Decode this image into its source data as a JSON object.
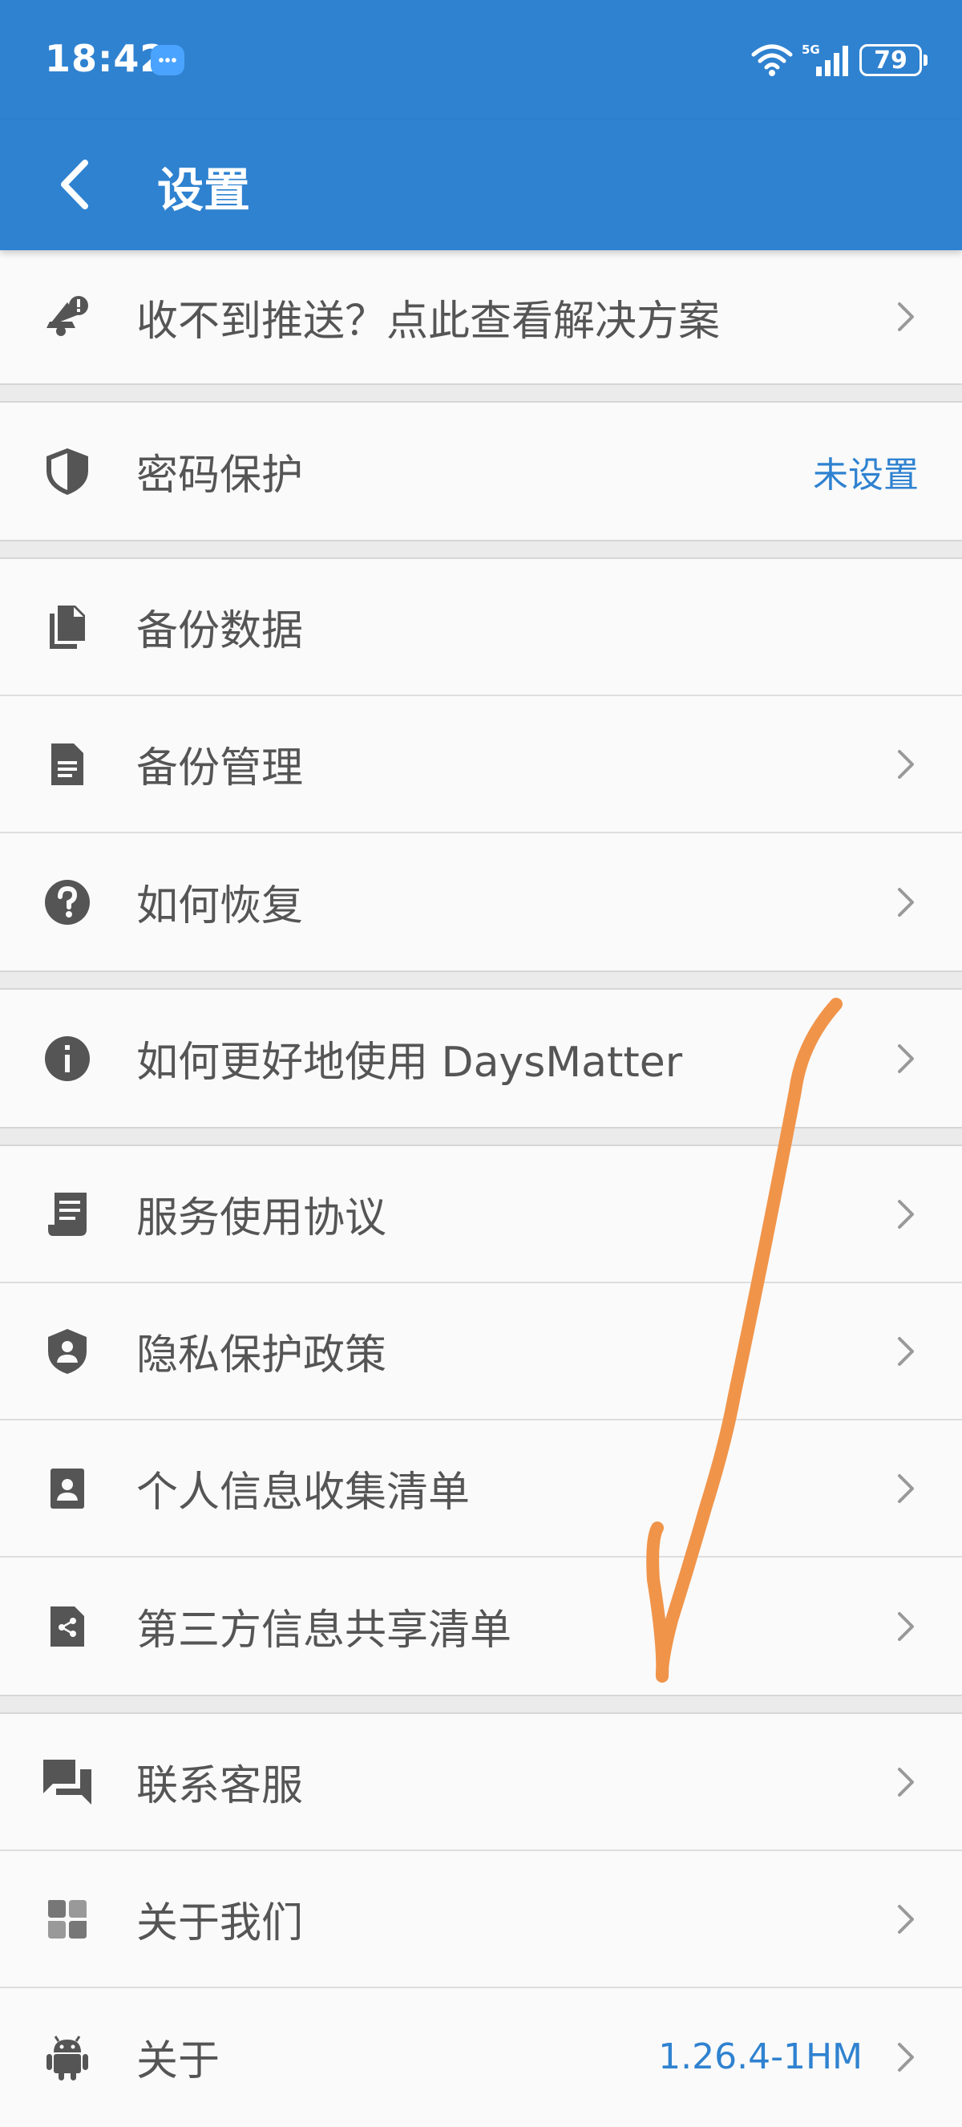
{
  "status_bar": {
    "time": "18:42",
    "battery": "79",
    "network": "5G"
  },
  "header": {
    "title": "设置"
  },
  "groups": [
    {
      "items": [
        {
          "label": "收不到推送？点此查看解决方案",
          "icon": "bell-alert-icon",
          "chevron": true
        }
      ]
    },
    {
      "items": [
        {
          "label": "密码保护",
          "icon": "shield-icon",
          "value": "未设置",
          "chevron": false
        }
      ]
    },
    {
      "items": [
        {
          "label": "备份数据",
          "icon": "copy-file-icon",
          "chevron": false
        },
        {
          "label": "备份管理",
          "icon": "document-icon",
          "chevron": true
        },
        {
          "label": "如何恢复",
          "icon": "help-icon",
          "chevron": true
        }
      ]
    },
    {
      "items": [
        {
          "label": "如何更好地使用 DaysMatter",
          "icon": "info-icon",
          "chevron": true
        }
      ]
    },
    {
      "items": [
        {
          "label": "服务使用协议",
          "icon": "receipt-icon",
          "chevron": true
        },
        {
          "label": "隐私保护政策",
          "icon": "shield-person-icon",
          "chevron": true
        },
        {
          "label": "个人信息收集清单",
          "icon": "contact-card-icon",
          "chevron": true
        },
        {
          "label": "第三方信息共享清单",
          "icon": "share-icon",
          "chevron": true
        }
      ]
    },
    {
      "items": [
        {
          "label": "联系客服",
          "icon": "chat-icon",
          "chevron": true
        },
        {
          "label": "关于我们",
          "icon": "clover-icon",
          "chevron": true
        },
        {
          "label": "关于",
          "icon": "android-icon",
          "value": "1.26.4-1HM",
          "chevron": true
        }
      ]
    }
  ],
  "colors": {
    "primary": "#2f82d0",
    "annotation": "#f0944a"
  }
}
